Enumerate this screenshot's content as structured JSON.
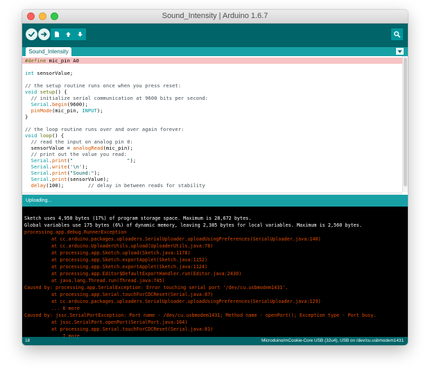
{
  "window": {
    "title": "Sound_Intensity | Arduino 1.6.7"
  },
  "toolbar": {
    "buttons": [
      {
        "name": "verify",
        "icon": "checkmark-icon"
      },
      {
        "name": "upload",
        "icon": "right-arrow-icon"
      },
      {
        "name": "new",
        "icon": "new-file-icon"
      },
      {
        "name": "open",
        "icon": "up-arrow-icon"
      },
      {
        "name": "save",
        "icon": "down-arrow-icon"
      },
      {
        "name": "serial-monitor",
        "icon": "magnifier-icon"
      }
    ]
  },
  "tabs": {
    "active": "Sound_Intensity",
    "menu_icon": "triangle-down-icon"
  },
  "editor": {
    "lines": [
      "#define mic_pin A0",
      "",
      "int sensorValue;",
      "",
      "// the setup routine runs once when you press reset:",
      "void setup() {",
      "  // initialize serial communication at 9600 bits per second:",
      "  Serial.begin(9600);",
      "  pinMode(mic_pin, INPUT);",
      "}",
      "",
      "// the loop routine runs over and over again forever:",
      "void loop() {",
      "  // read the input on analog pin 0:",
      "  sensorValue = analogRead(mic_pin);",
      "  // print out the value you read:",
      "  Serial.print(\"                  \");",
      "  Serial.write('\\n');",
      "  Serial.print(\"Sound:\");",
      "  Serial.print(sensorValue);",
      "  delay(100);        // delay in between reads for stability"
    ]
  },
  "status": {
    "message": "Uploading..."
  },
  "console": {
    "lines": [
      {
        "text": "",
        "kind": "white"
      },
      {
        "text": "Sketch uses 4,950 bytes (17%) of program storage space. Maximum is 28,672 bytes.",
        "kind": "white"
      },
      {
        "text": "Global variables use 175 bytes (6%) of dynamic memory, leaving 2,385 bytes for local variables. Maximum is 2,560 bytes.",
        "kind": "white"
      },
      {
        "text": "processing.app.debug.RunnerException",
        "kind": "err"
      },
      {
        "text": "at cc.arduino.packages.uploaders.SerialUploader.uploadUsingPreferences(SerialUploader.java:140)",
        "kind": "err-indent"
      },
      {
        "text": "at cc.arduino.UploaderUtils.upload(UploaderUtils.java:78)",
        "kind": "err-indent"
      },
      {
        "text": "at processing.app.Sketch.upload(Sketch.java:1178)",
        "kind": "err-indent"
      },
      {
        "text": "at processing.app.Sketch.exportApplet(Sketch.java:1152)",
        "kind": "err-indent"
      },
      {
        "text": "at processing.app.Sketch.exportApplet(Sketch.java:1124)",
        "kind": "err-indent"
      },
      {
        "text": "at processing.app.Editor$DefaultExportHandler.run(Editor.java:2430)",
        "kind": "err-indent"
      },
      {
        "text": "at java.lang.Thread.run(Thread.java:745)",
        "kind": "err-indent"
      },
      {
        "text": "Caused by: processing.app.SerialException: Error touching serial port '/dev/cu.usbmodem1431'.",
        "kind": "err"
      },
      {
        "text": "at processing.app.Serial.touchForCDCReset(Serial.java:87)",
        "kind": "err-indent"
      },
      {
        "text": "at cc.arduino.packages.uploaders.SerialUploader.uploadUsingPreferences(SerialUploader.java:129)",
        "kind": "err-indent"
      },
      {
        "text": "... 6 more",
        "kind": "err-indent"
      },
      {
        "text": "Caused by: jssc.SerialPortException: Port name - /dev/cu.usbmodem1431; Method name - openPort(); Exception type - Port busy.",
        "kind": "err"
      },
      {
        "text": "at jssc.SerialPort.openPort(SerialPort.java:164)",
        "kind": "err-indent"
      },
      {
        "text": "at processing.app.Serial.touchForCDCReset(Serial.java:81)",
        "kind": "err-indent"
      },
      {
        "text": "... 7 more",
        "kind": "err-indent"
      }
    ]
  },
  "footer": {
    "line_number": "18",
    "board": "Microduino/mCookie-Core USB (32u4), USB on /dev/cu.usbmodem1431"
  },
  "colors": {
    "toolbar": "#006468",
    "accent": "#17a1a5",
    "error_text": "#e34c00",
    "highlight_line": "#f7c3c4"
  }
}
